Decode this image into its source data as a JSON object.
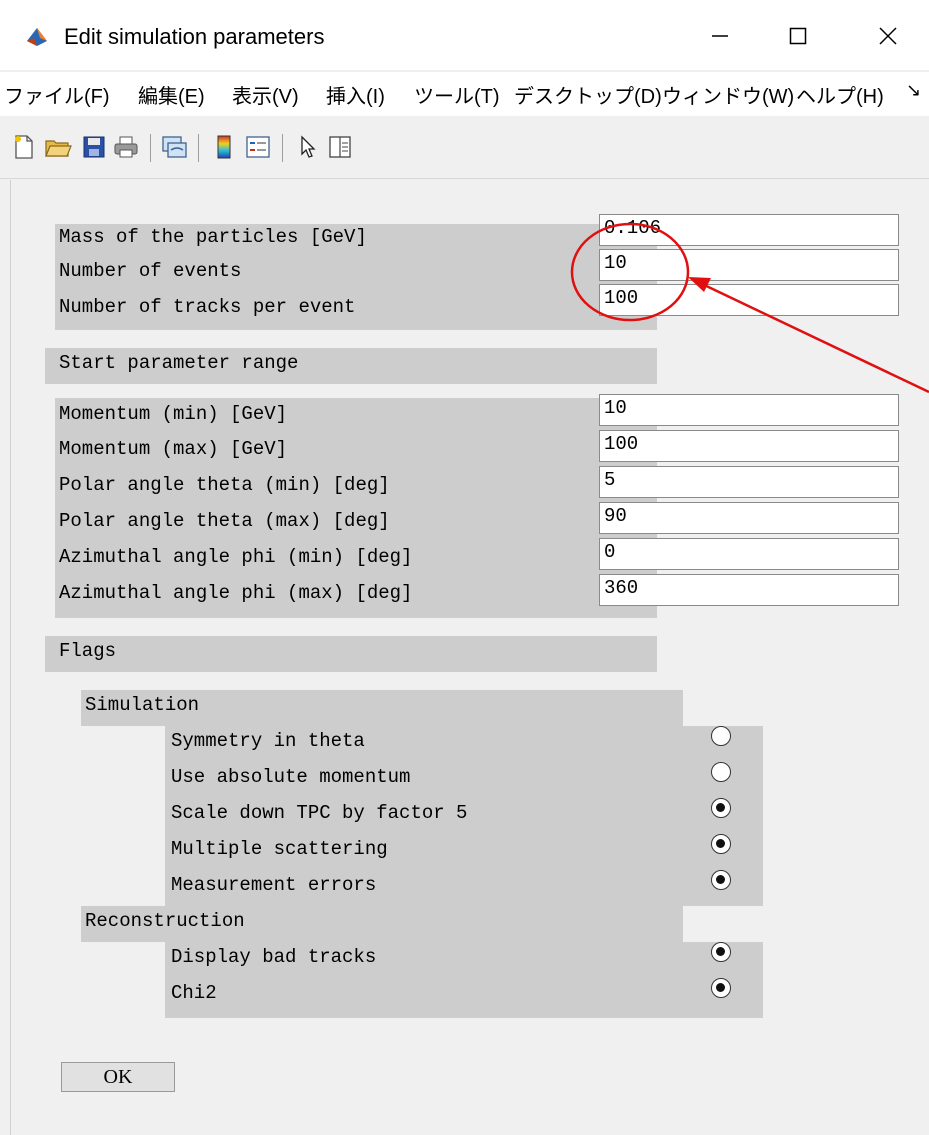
{
  "window": {
    "title": "Edit simulation parameters",
    "icon": "matlab-logo-icon",
    "controls": {
      "minimize": "minimize-icon",
      "maximize": "maximize-icon",
      "close": "close-icon"
    }
  },
  "menu": {
    "items": [
      {
        "label": "ファイル(F)"
      },
      {
        "label": "編集(E)"
      },
      {
        "label": "表示(V)"
      },
      {
        "label": "挿入(I)"
      },
      {
        "label": "ツール(T)"
      },
      {
        "label": "デスクトップ(D)"
      },
      {
        "label": "ウィンドウ(W)"
      },
      {
        "label": "ヘルプ(H)"
      }
    ],
    "overflow": "↘"
  },
  "toolbar": {
    "buttons": [
      "new-file-icon",
      "open-folder-icon",
      "save-icon",
      "print-icon",
      "link-plot-icon",
      "colorbar-icon",
      "legend-icon",
      "pointer-icon",
      "property-inspector-icon"
    ]
  },
  "params": {
    "mass_label": "Mass of the particles [GeV]",
    "mass_value": "0.106",
    "events_label": "Number of events",
    "events_value": "10",
    "tracks_label": "Number of tracks per event",
    "tracks_value": "100"
  },
  "range": {
    "header": "Start parameter range",
    "rows": [
      {
        "label": "Momentum (min) [GeV]",
        "value": "10"
      },
      {
        "label": "Momentum (max) [GeV]",
        "value": "100"
      },
      {
        "label": "Polar angle theta (min) [deg]",
        "value": "5"
      },
      {
        "label": "Polar angle theta (max) [deg]",
        "value": "90"
      },
      {
        "label": "Azimuthal angle phi (min) [deg]",
        "value": "0"
      },
      {
        "label": "Azimuthal angle phi (max) [deg]",
        "value": "360"
      }
    ]
  },
  "flags": {
    "header": "Flags",
    "simulation": {
      "header": "Simulation",
      "items": [
        {
          "label": "Symmetry in theta",
          "checked": false
        },
        {
          "label": "Use absolute momentum",
          "checked": false
        },
        {
          "label": "Scale down TPC by factor 5",
          "checked": true
        },
        {
          "label": "Multiple scattering",
          "checked": true
        },
        {
          "label": "Measurement errors",
          "checked": true
        }
      ]
    },
    "reconstruction": {
      "header": "Reconstruction",
      "items": [
        {
          "label": "Display bad tracks",
          "checked": true
        },
        {
          "label": "Chi2",
          "checked": true
        }
      ]
    }
  },
  "ok_label": "OK",
  "annotation_color": "#e01010"
}
